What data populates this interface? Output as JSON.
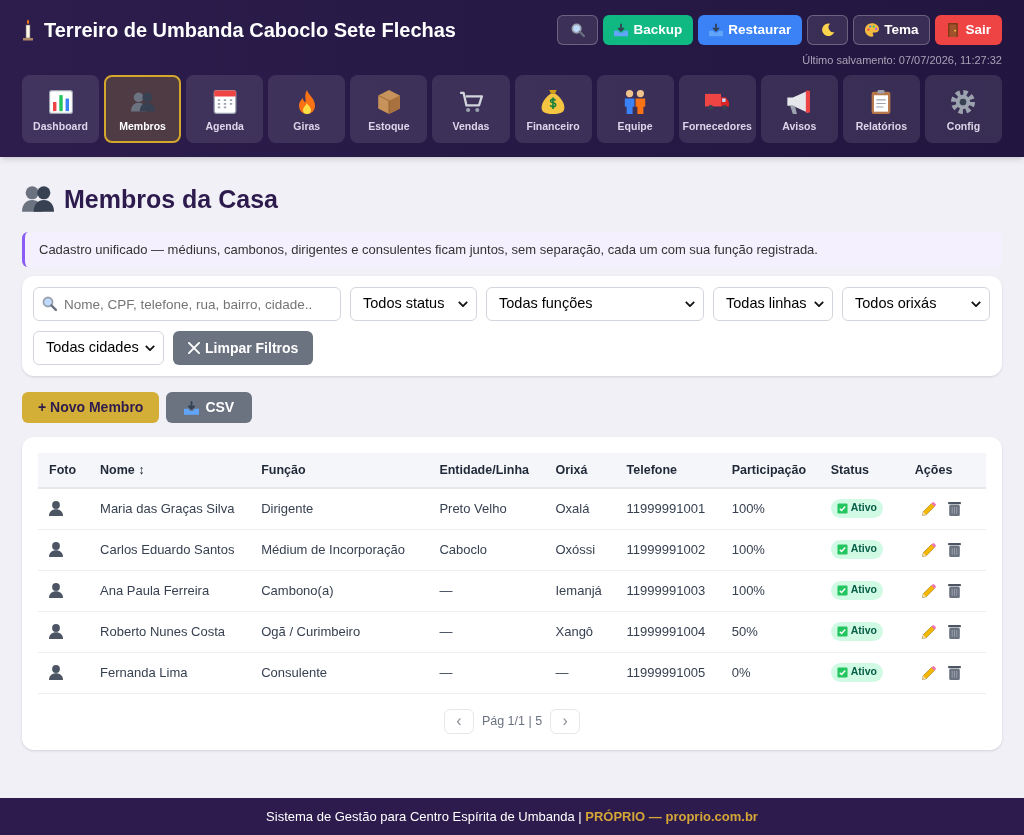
{
  "header": {
    "title": "Terreiro de Umbanda Caboclo Sete Flechas",
    "buttons": [
      {
        "kind": "ghost"
      },
      {
        "kind": "success",
        "label": "Backup"
      },
      {
        "kind": "primary",
        "label": "Restaurar"
      },
      {
        "kind": "ghost"
      },
      {
        "kind": "ghost",
        "label": "Tema"
      },
      {
        "kind": "danger",
        "label": "Sair"
      }
    ],
    "last_saved": "Último salvamento: 07/07/2026, 11:27:32"
  },
  "nav": [
    {
      "label": "Dashboard",
      "selected": false
    },
    {
      "label": "Membros",
      "selected": true
    },
    {
      "label": "Agenda",
      "selected": false
    },
    {
      "label": "Giras",
      "selected": false
    },
    {
      "label": "Estoque",
      "selected": false
    },
    {
      "label": "Vendas",
      "selected": false
    },
    {
      "label": "Financeiro",
      "selected": false
    },
    {
      "label": "Equipe",
      "selected": false
    },
    {
      "label": "Fornecedores",
      "selected": false
    },
    {
      "label": "Avisos",
      "selected": false
    },
    {
      "label": "Relatórios",
      "selected": false
    },
    {
      "label": "Config",
      "selected": false
    }
  ],
  "page": {
    "title": "Membros da Casa",
    "notice": "Cadastro unificado — médiuns, cambonos, dirigentes e consulentes ficam juntos, sem separação, cada um com sua função registrada."
  },
  "filters": {
    "search": {
      "placeholder": "Nome, CPF, telefone, rua, bairro, cidade.."
    },
    "dropdowns": [
      {
        "value": "Todos status"
      },
      {
        "value": "Todas funções"
      },
      {
        "value": "Todas linhas"
      },
      {
        "value": "Todos orixás"
      },
      {
        "value": "Todas cidades"
      }
    ],
    "clear_button": "Limpar Filtros"
  },
  "actions": [
    {
      "kind": "primary",
      "label": "+ Novo Membro"
    },
    {
      "kind": "secondary",
      "label": "CSV"
    }
  ],
  "table": {
    "columns": [
      "Foto",
      "Nome ↕",
      "Função",
      "Entidade/Linha",
      "Orixá",
      "Telefone",
      "Participação",
      "Status",
      "Ações"
    ],
    "rows": [
      {
        "name": "Maria das Graças Silva",
        "function": "Dirigente",
        "entity": "Preto Velho",
        "orixa": "Oxalá",
        "phone": "11999991001",
        "participation": "100%",
        "status": "Ativo"
      },
      {
        "name": "Carlos Eduardo Santos",
        "function": "Médium de Incorporação",
        "entity": "Caboclo",
        "orixa": "Oxóssi",
        "phone": "11999991002",
        "participation": "100%",
        "status": "Ativo"
      },
      {
        "name": "Ana Paula Ferreira",
        "function": "Cambono(a)",
        "entity": "—",
        "orixa": "Iemanjá",
        "phone": "11999991003",
        "participation": "100%",
        "status": "Ativo"
      },
      {
        "name": "Roberto Nunes Costa",
        "function": "Ogã / Curimbeiro",
        "entity": "—",
        "orixa": "Xangô",
        "phone": "11999991004",
        "participation": "50%",
        "status": "Ativo"
      },
      {
        "name": "Fernanda Lima",
        "function": "Consulente",
        "entity": "—",
        "orixa": "—",
        "phone": "11999991005",
        "participation": "0%",
        "status": "Ativo"
      }
    ]
  },
  "pagination": {
    "prev": {
      "label": "‹",
      "disabled": true
    },
    "info": "Pág 1/1 | 5",
    "next": {
      "label": "›",
      "disabled": true
    }
  },
  "footer": "Sistema de Gestão para Centro Espírita de Umbanda | **PRÓPRIO — proprio.com.br**"
}
